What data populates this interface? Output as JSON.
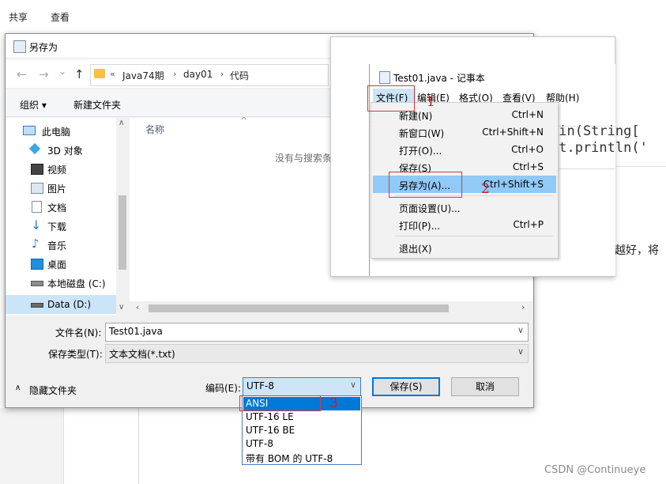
{
  "background": {
    "ribbon_tabs": [
      "共享",
      "查看"
    ],
    "article_snippet": "越好，将"
  },
  "save_dialog": {
    "title": "另存为",
    "nav_buttons": [
      "←",
      "→",
      "⌄",
      "↑"
    ],
    "breadcrumb": {
      "overflow": "«",
      "parts": [
        "Java74期",
        "day01",
        "代码"
      ]
    },
    "toolbar": {
      "organize_label": "组织 ▾",
      "new_folder_label": "新建文件夹"
    },
    "nav_items": [
      {
        "label": "此电脑",
        "icon": "computer-icon"
      },
      {
        "label": "3D 对象",
        "icon": "cube-icon"
      },
      {
        "label": "视频",
        "icon": "video-icon"
      },
      {
        "label": "图片",
        "icon": "picture-icon"
      },
      {
        "label": "文档",
        "icon": "document-icon"
      },
      {
        "label": "下载",
        "icon": "download-icon"
      },
      {
        "label": "音乐",
        "icon": "music-icon"
      },
      {
        "label": "桌面",
        "icon": "desktop-icon"
      },
      {
        "label": "本地磁盘 (C:)",
        "icon": "disk-icon"
      },
      {
        "label": "Data (D:)",
        "icon": "disk-icon"
      }
    ],
    "file_list": {
      "column_name": "名称",
      "empty_message": "没有与搜索条"
    },
    "filename": {
      "label": "文件名(N):",
      "value": "Test01.java"
    },
    "filetype": {
      "label": "保存类型(T):",
      "value": "文本文档(*.txt)"
    },
    "hide_folders_label": "隐藏文件夹",
    "encoding": {
      "label": "编码(E):",
      "value": "UTF-8",
      "options": [
        "ANSI",
        "UTF-16 LE",
        "UTF-16 BE",
        "UTF-8",
        "带有 BOM 的 UTF-8"
      ],
      "highlighted": "ANSI"
    },
    "save_button": "保存(S)",
    "cancel_button": "取消"
  },
  "notepad": {
    "title": "Test01.java - 记事本",
    "menus": [
      "文件(F)",
      "编辑(E)",
      "格式(O)",
      "查看(V)",
      "帮助(H)"
    ],
    "code_lines": [
      "ain(String[",
      "ut.println('"
    ],
    "file_menu": [
      {
        "label": "新建(N)",
        "shortcut": "Ctrl+N"
      },
      {
        "label": "新窗口(W)",
        "shortcut": "Ctrl+Shift+N"
      },
      {
        "label": "打开(O)...",
        "shortcut": "Ctrl+O"
      },
      {
        "label": "保存(S)",
        "shortcut": "Ctrl+S"
      },
      {
        "label": "另存为(A)...",
        "shortcut": "Ctrl+Shift+S"
      },
      {
        "label": "页面设置(U)...",
        "shortcut": ""
      },
      {
        "label": "打印(P)...",
        "shortcut": "Ctrl+P"
      },
      {
        "label": "退出(X)",
        "shortcut": ""
      }
    ]
  },
  "annotations": {
    "step1": "1",
    "step2": "2",
    "step3": "3",
    "color": "#c81e1e"
  },
  "watermark": "CSDN @Continueye"
}
